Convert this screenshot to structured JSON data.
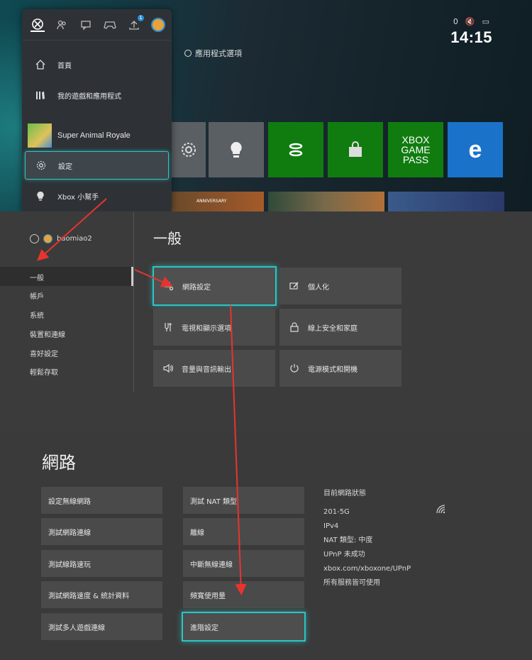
{
  "home": {
    "clock": "14:15",
    "status_badge": "0",
    "app_options_label": "應用程式選項",
    "gamepass_tile": [
      "XBOX",
      "GAME",
      "PASS"
    ],
    "edge_tile": "e",
    "banner_text": "ANNIVERSARY"
  },
  "guide": {
    "tabs": [
      "xbox-icon",
      "people-icon",
      "chat-icon",
      "controller-icon",
      "upload-icon",
      "avatar"
    ],
    "upload_badge": "1",
    "items": [
      {
        "label": "首頁",
        "icon": "home-icon"
      },
      {
        "label": "我的遊戲和應用程式",
        "icon": "library-icon"
      },
      {
        "label": "Super Animal Royale",
        "icon": "game-thumbnail"
      },
      {
        "label": "設定",
        "icon": "gear-icon"
      },
      {
        "label": "Xbox 小幫手",
        "icon": "lightbulb-icon"
      }
    ]
  },
  "settings": {
    "username": "baomiao2",
    "categories": [
      "一般",
      "帳戶",
      "系統",
      "裝置和連線",
      "喜好設定",
      "輕鬆存取"
    ],
    "section_title": "一般",
    "cards": [
      {
        "label": "網路設定",
        "icon": "network-settings-icon"
      },
      {
        "label": "個人化",
        "icon": "personalize-icon"
      },
      {
        "label": "電視和顯示選項",
        "icon": "tv-display-icon"
      },
      {
        "label": "線上安全和家庭",
        "icon": "lock-icon"
      },
      {
        "label": "音量與音訊輸出",
        "icon": "volume-icon"
      },
      {
        "label": "電源模式和開機",
        "icon": "power-icon"
      }
    ]
  },
  "network": {
    "title": "網路",
    "left_column": [
      "設定無線網路",
      "測試網路連線",
      "測試線路速玩",
      "測試網路速度 & 統計資料",
      "測試多人遊戲連線"
    ],
    "mid_column": [
      "測試 NAT 類型",
      "離線",
      "中斷無線連線",
      "頻寬使用量",
      "進階設定"
    ],
    "status": {
      "heading": "目前網路狀態",
      "lines": [
        "201-5G",
        "IPv4",
        "NAT 類型: 中度",
        "UPnP 未成功",
        "xbox.com/xboxone/UPnP",
        "所有服務皆可使用"
      ]
    }
  },
  "colors": {
    "focus_accent": "#2ec4c4",
    "xbox_green": "#107c10",
    "arrow_red": "#e8342e"
  }
}
